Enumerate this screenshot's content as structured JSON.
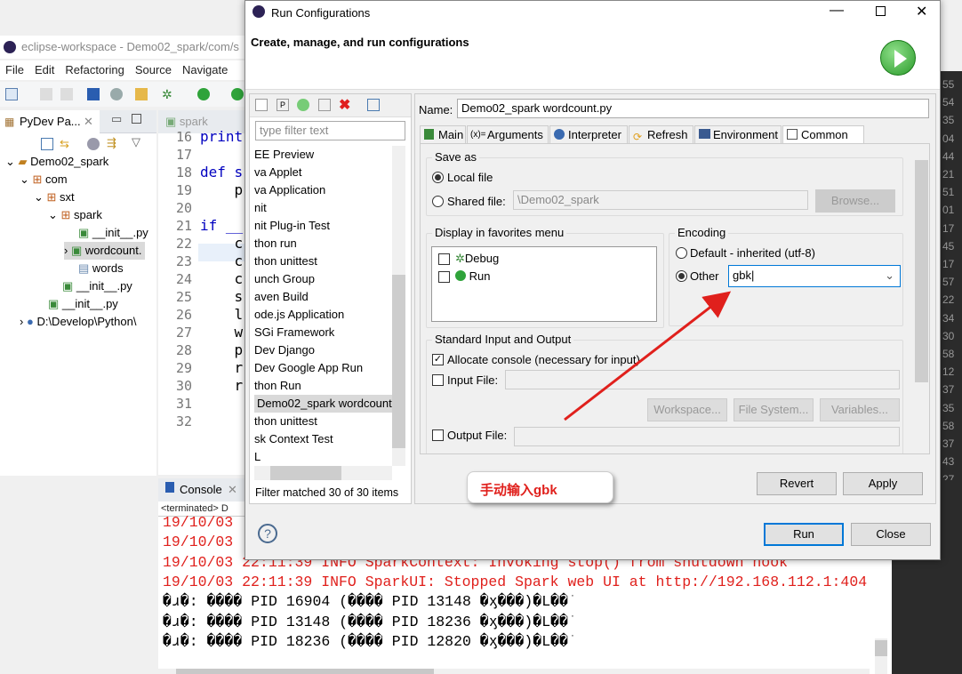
{
  "eclipse": {
    "title": "eclipse-workspace - Demo02_spark/com/s",
    "menu": [
      "File",
      "Edit",
      "Refactoring",
      "Source",
      "Navigate"
    ],
    "package_tab": "PyDev Pa...",
    "tree": [
      "Demo02_spark",
      "com",
      "sxt",
      "spark",
      "__init__.py",
      "wordcount.",
      "words",
      "__init__.py",
      "__init__.py",
      "D:\\Develop\\Python\\"
    ],
    "editor_tabs": [
      "spark"
    ],
    "line_numbers": [
      "16",
      "17",
      "18",
      "19",
      "20",
      "21",
      "22",
      "23",
      "24",
      "25",
      "26",
      "27",
      "28",
      "29",
      "30",
      "31",
      "32"
    ],
    "code": [
      "print",
      "",
      "def s",
      "    p",
      "",
      "if __",
      "    c",
      "    c",
      "    c",
      "    s",
      "    l",
      "    w",
      "    p",
      "    r",
      "    r",
      "",
      ""
    ],
    "right_numbers": [
      "55",
      "54",
      "35",
      "04",
      "44",
      "21",
      "51",
      "01",
      "17",
      "45",
      "17",
      "57",
      "22",
      "34",
      "30",
      "58",
      "12",
      "37",
      "35",
      "58",
      "37",
      "43",
      "27"
    ]
  },
  "console": {
    "tab": "Console",
    "status": "<terminated> D",
    "lines": [
      "19/10/03",
      "19/10/03",
      "19/10/03 22:11:39 INFO SparkContext: Invoking stop() from shutdown hook",
      "19/10/03 22:11:39 INFO SparkUI: Stopped Spark web UI at http://192.168.112.1:404",
      "�ɹ�: ���� PID 16904 (���� PID 13148 �ӽ���)�L��ֹ",
      "�ɹ�: ���� PID 13148 (���� PID 18236 �ӽ���)�L��ֹ",
      "�ɹ�: ���� PID 18236 (���� PID 12820 �ӽ���)�L��ֹ"
    ]
  },
  "dialog": {
    "title": "Run Configurations",
    "header": "Create, manage, and run configurations",
    "filter_placeholder": "type filter text",
    "config_list": [
      "EE Preview",
      "va Applet",
      "va Application",
      "nit",
      "nit Plug-in Test",
      "thon run",
      "thon unittest",
      "unch Group",
      "aven Build",
      "ode.js Application",
      "SGi Framework",
      "Dev Django",
      "Dev Google App Run",
      "thon Run",
      "Demo02_spark wordcount",
      "thon unittest",
      "sk Context Test",
      "L"
    ],
    "selected_index": 14,
    "filter_status": "Filter matched 30 of 30 items",
    "name_label": "Name:",
    "name_value": "Demo02_spark wordcount.py",
    "tabs": [
      "Main",
      "Arguments",
      "Interpreter",
      "Refresh",
      "Environment",
      "Common"
    ],
    "active_tab": "Common",
    "save_as": {
      "label": "Save as",
      "local": "Local file",
      "shared": "Shared file:",
      "shared_value": "\\Demo02_spark",
      "browse": "Browse..."
    },
    "favorites": {
      "label": "Display in favorites menu",
      "items": [
        "Debug",
        "Run"
      ]
    },
    "encoding": {
      "label": "Encoding",
      "default": "Default - inherited (utf-8)",
      "other": "Other",
      "other_value": "gbk"
    },
    "std_io": {
      "label": "Standard Input and Output",
      "allocate": "Allocate console (necessary for input)",
      "input": "Input File:",
      "output": "Output File:",
      "workspace": "Workspace...",
      "filesystem": "File System...",
      "variables": "Variables..."
    },
    "revert": "Revert",
    "apply": "Apply",
    "run": "Run",
    "close": "Close"
  },
  "annotation": {
    "text": "手动输入gbk",
    "color": "#e0201c"
  }
}
